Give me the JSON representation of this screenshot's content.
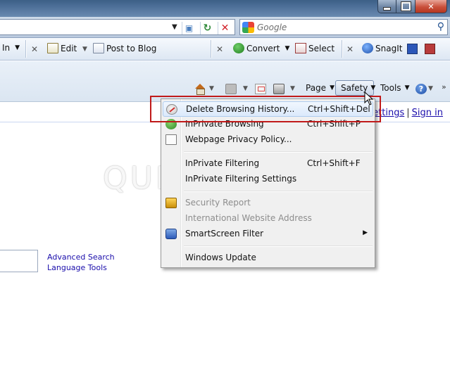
{
  "address_bar": {
    "search_placeholder": "Google"
  },
  "plugin_toolbar": {
    "items": [
      {
        "label": "In"
      },
      {
        "label": "Edit"
      },
      {
        "label": "Post to Blog"
      },
      {
        "label": "Convert"
      },
      {
        "label": "Select"
      },
      {
        "label": "SnagIt"
      }
    ]
  },
  "command_bar": {
    "page": "Page",
    "safety": "Safety",
    "tools": "Tools"
  },
  "page": {
    "top_links": [
      "settings",
      "Sign in"
    ],
    "advanced_search": "Advanced Search",
    "language_tools": "Language Tools",
    "watermark": "QUICKSTARTS"
  },
  "safety_menu": {
    "items": [
      {
        "label": "Delete Browsing History...",
        "shortcut": "Ctrl+Shift+Del",
        "icon": "delete-history-icon",
        "enabled": true
      },
      {
        "label": "InPrivate Browsing",
        "shortcut": "Ctrl+Shift+P",
        "icon": "inprivate-icon",
        "enabled": true
      },
      {
        "label": "Webpage Privacy Policy...",
        "shortcut": "",
        "icon": "privacy-policy-icon",
        "enabled": true
      },
      {
        "label": "InPrivate Filtering",
        "shortcut": "Ctrl+Shift+F",
        "icon": "",
        "enabled": true
      },
      {
        "label": "InPrivate Filtering Settings",
        "shortcut": "",
        "icon": "",
        "enabled": true
      },
      {
        "label": "Security Report",
        "shortcut": "",
        "icon": "lock-icon",
        "enabled": false
      },
      {
        "label": "International Website Address",
        "shortcut": "",
        "icon": "",
        "enabled": false
      },
      {
        "label": "SmartScreen Filter",
        "shortcut": "",
        "icon": "smartscreen-icon",
        "enabled": true
      },
      {
        "label": "Windows Update",
        "shortcut": "",
        "icon": "",
        "enabled": true
      }
    ]
  },
  "colors": {
    "highlight_frame": "#c01a1a",
    "link": "#1a0dab",
    "menu_bg": "#f0f0f0"
  }
}
